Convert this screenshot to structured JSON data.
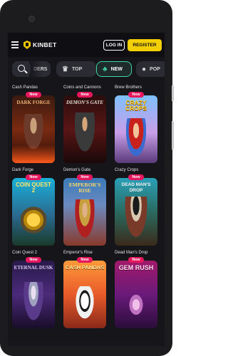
{
  "header": {
    "logo_text": "KINBET",
    "login_label": "LOG IN",
    "register_label": "REGISTER"
  },
  "tabs": [
    {
      "label": "DERS",
      "icon": "gift-icon"
    },
    {
      "label": "TOP",
      "icon": "crown-icon"
    },
    {
      "label": "NEW",
      "icon": "clover-icon",
      "active": true
    },
    {
      "label": "POP",
      "icon": "bomb-icon"
    }
  ],
  "top_row_labels": [
    "Cash Pandas",
    "Coins and Cannons",
    "Brew Brothers"
  ],
  "badge_label": "New",
  "games": [
    {
      "name": "Dark Forge",
      "art_title": "DARK FORGE"
    },
    {
      "name": "Demon's Gate",
      "art_title": "DEMON'S GATE"
    },
    {
      "name": "Crazy Crops",
      "art_title": "CRAZY CROPS"
    },
    {
      "name": "Coin Quest 2",
      "art_title": "COIN QUEST 2"
    },
    {
      "name": "Emperor's Rise",
      "art_title": "EMPEROR'S RISE"
    },
    {
      "name": "Dead Man's Drop",
      "art_title": "DEAD MAN'S DROP"
    },
    {
      "name": "Eternal Dusk",
      "art_title": "ETERNAL DUSK"
    },
    {
      "name": "Cash Pandas",
      "art_title": "CASH PANDAS"
    },
    {
      "name": "Gem Rush",
      "art_title": "GEM RUSH"
    }
  ],
  "colors": {
    "accent": "#f5d000",
    "new_badge": "#e6175c",
    "active_tab_border": "#3ed6a5"
  }
}
